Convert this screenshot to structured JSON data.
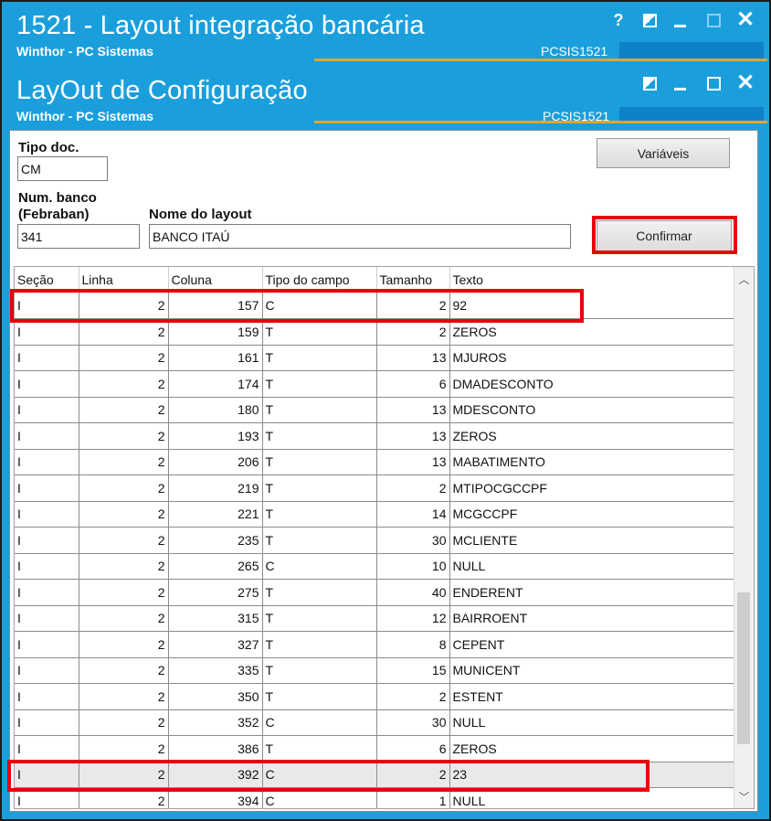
{
  "outer_window": {
    "title": "1521 - Layout integração bancária",
    "subtitle": "Winthor - PC Sistemas",
    "code": "PCSIS1521"
  },
  "inner_window": {
    "title": "LayOut de Configuração",
    "subtitle": "Winthor - PC Sistemas",
    "code": "PCSIS1521"
  },
  "form": {
    "tipo_doc_label": "Tipo doc.",
    "tipo_doc_value": "CM",
    "num_banco_label_1": "Num. banco",
    "num_banco_label_2": "(Febraban)",
    "num_banco_value": "341",
    "nome_layout_label": "Nome do layout",
    "nome_layout_value": "BANCO ITAÚ",
    "variaveis_button": "Variáveis",
    "confirmar_button": "Confirmar"
  },
  "grid": {
    "columns": [
      "Seção",
      "Linha",
      "Coluna",
      "Tipo do campo",
      "Tamanho",
      "Texto"
    ],
    "rows": [
      [
        "I",
        "2",
        "157",
        "C",
        "2",
        "92"
      ],
      [
        "I",
        "2",
        "159",
        "T",
        "2",
        "ZEROS"
      ],
      [
        "I",
        "2",
        "161",
        "T",
        "13",
        "MJUROS"
      ],
      [
        "I",
        "2",
        "174",
        "T",
        "6",
        "DMADESCONTO"
      ],
      [
        "I",
        "2",
        "180",
        "T",
        "13",
        "MDESCONTO"
      ],
      [
        "I",
        "2",
        "193",
        "T",
        "13",
        "ZEROS"
      ],
      [
        "I",
        "2",
        "206",
        "T",
        "13",
        "MABATIMENTO"
      ],
      [
        "I",
        "2",
        "219",
        "T",
        "2",
        "MTIPOCGCCPF"
      ],
      [
        "I",
        "2",
        "221",
        "T",
        "14",
        "MCGCCPF"
      ],
      [
        "I",
        "2",
        "235",
        "T",
        "30",
        "MCLIENTE"
      ],
      [
        "I",
        "2",
        "265",
        "C",
        "10",
        "NULL"
      ],
      [
        "I",
        "2",
        "275",
        "T",
        "40",
        "ENDERENT"
      ],
      [
        "I",
        "2",
        "315",
        "T",
        "12",
        "BAIRROENT"
      ],
      [
        "I",
        "2",
        "327",
        "T",
        "8",
        "CEPENT"
      ],
      [
        "I",
        "2",
        "335",
        "T",
        "15",
        "MUNICENT"
      ],
      [
        "I",
        "2",
        "350",
        "T",
        "2",
        "ESTENT"
      ],
      [
        "I",
        "2",
        "352",
        "C",
        "30",
        "NULL"
      ],
      [
        "I",
        "2",
        "386",
        "T",
        "6",
        "ZEROS"
      ],
      [
        "I",
        "2",
        "392",
        "C",
        "2",
        "23"
      ],
      [
        "I",
        "2",
        "394",
        "C",
        "1",
        "NULL"
      ]
    ],
    "selected_row": 18
  },
  "colors": {
    "titlebar": "#1a9fdc",
    "highlight": "#e8000b",
    "accent_line": "#e0a531"
  },
  "icons": [
    "help-icon",
    "restore-icon",
    "minimize-icon",
    "maximize-icon",
    "close-icon",
    "scroll-up-icon",
    "scroll-down-icon"
  ]
}
